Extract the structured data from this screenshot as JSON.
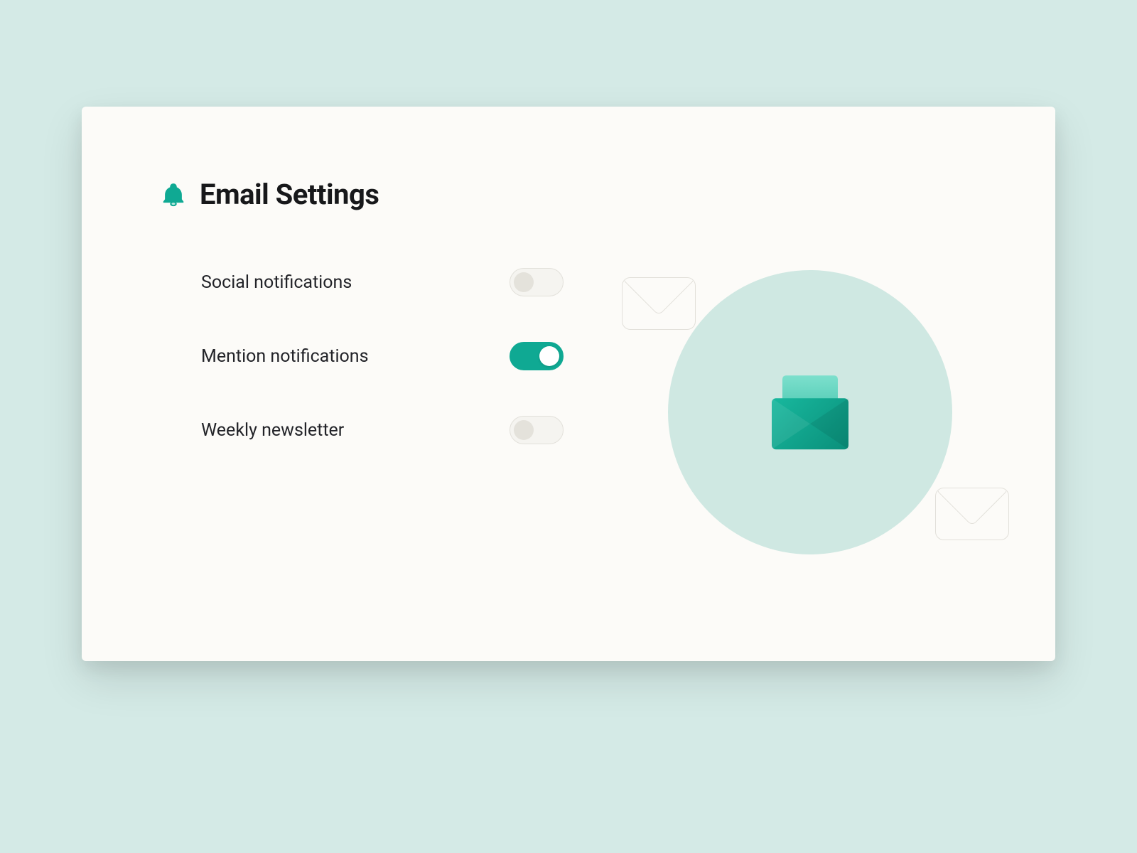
{
  "header": {
    "title": "Email Settings"
  },
  "settings": [
    {
      "label": "Social notifications",
      "on": false
    },
    {
      "label": "Mention notifications",
      "on": true
    },
    {
      "label": "Weekly newsletter",
      "on": false
    }
  ],
  "colors": {
    "accent": "#0fa993",
    "background": "#d4eae6",
    "card": "#fcfbf8"
  }
}
